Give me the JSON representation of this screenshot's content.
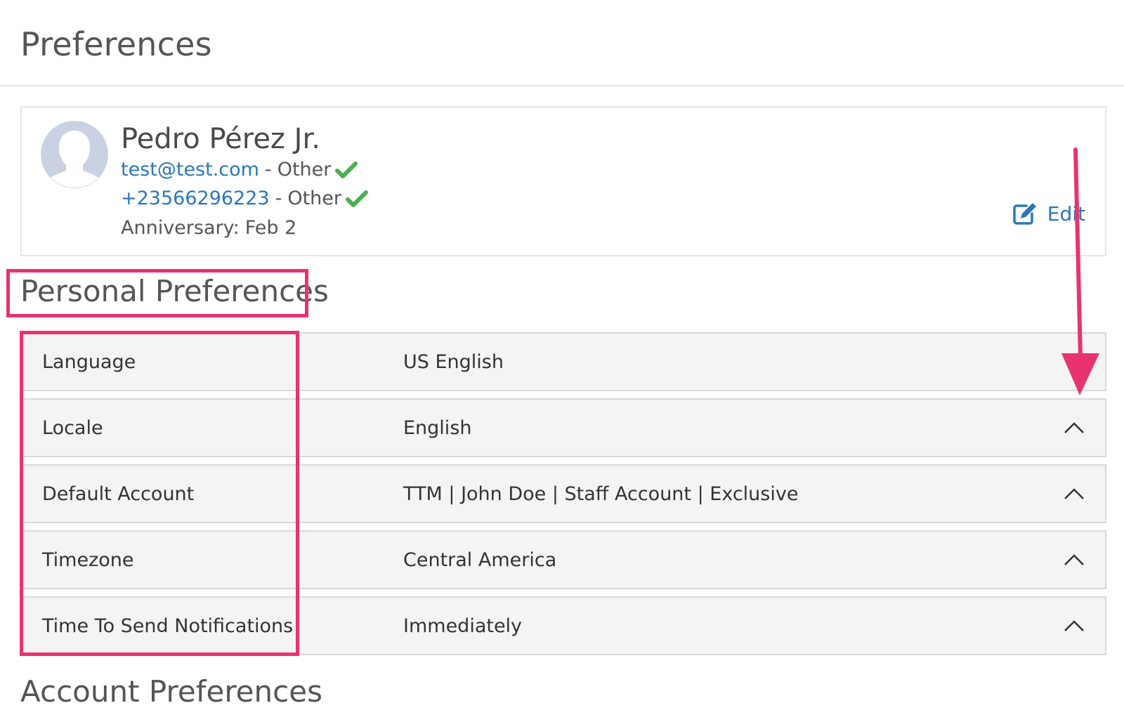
{
  "header": {
    "title": "Preferences"
  },
  "profile": {
    "name": "Pedro Pérez Jr.",
    "email": "test@test.com",
    "email_type": "Other",
    "phone": "+23566296223",
    "phone_type": "Other",
    "separator": "-",
    "anniversary_label": "Anniversary:",
    "anniversary_value": "Feb 2",
    "edit_label": "Edit",
    "verified_icon": "check-icon",
    "edit_icon": "edit-icon"
  },
  "personal_preferences": {
    "title": "Personal Preferences",
    "rows": [
      {
        "label": "Language",
        "value": "US English"
      },
      {
        "label": "Locale",
        "value": "English"
      },
      {
        "label": "Default Account",
        "value": "TTM | John Doe | Staff Account | Exclusive"
      },
      {
        "label": "Timezone",
        "value": "Central America"
      },
      {
        "label": "Time To Send Notifications",
        "value": "Immediately"
      }
    ]
  },
  "account_preferences": {
    "title": "Account Preferences"
  },
  "colors": {
    "link": "#2b77b9",
    "verified": "#4caf50",
    "annotation": "#e8336e",
    "row_background": "#f4f4f4",
    "avatar": "#c9d1e3"
  }
}
